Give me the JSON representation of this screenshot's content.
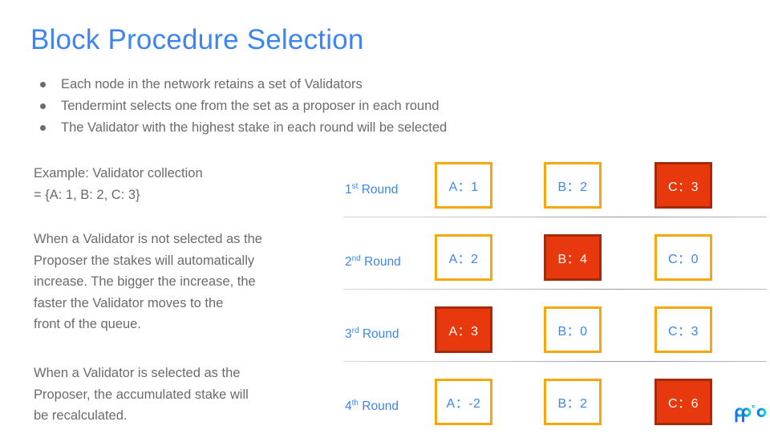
{
  "slide": {
    "title": "Block Procedure Selection",
    "background": "#ffffff",
    "accent_blue": "#3d85f0",
    "accent_orange": "#f8a70b",
    "accent_red": "#e8380d",
    "accent_red_border": "#a52a0a",
    "body_gray": "#6b6b6b"
  },
  "bullets": [
    {
      "text": "Each node in the network retains a set of Validators"
    },
    {
      "text": "Tendermint selects one from the set as a proposer in each round"
    },
    {
      "text": "The Validator with the highest stake in each round will be selected"
    }
  ],
  "paragraphs": {
    "example": {
      "lines": [
        "Example: Validator collection",
        "= {A: 1, B: 2, C: 3}"
      ]
    },
    "not_selected": {
      "lines": [
        "When a Validator is not selected as the",
        "Proposer the stakes will automatically",
        "increase. The bigger the increase, the",
        "faster the Validator moves to the",
        "front of the queue."
      ]
    },
    "selected": {
      "lines": [
        "When a Validator is selected as the",
        "Proposer, the accumulated stake will",
        "be recalculated."
      ]
    }
  },
  "diagram": {
    "rounds": [
      {
        "label_number": "1",
        "label_ordinal": "st",
        "label_suffix": " Round",
        "boxes": [
          {
            "label": "A：1",
            "selected": false
          },
          {
            "label": "B：2",
            "selected": false
          },
          {
            "label": "C：3",
            "selected": true
          }
        ]
      },
      {
        "label_number": "2",
        "label_ordinal": "nd",
        "label_suffix": " Round",
        "boxes": [
          {
            "label": "A：2",
            "selected": false
          },
          {
            "label": "B：4",
            "selected": true
          },
          {
            "label": "C：0",
            "selected": false
          }
        ]
      },
      {
        "label_number": "3",
        "label_ordinal": "rd",
        "label_suffix": " Round",
        "boxes": [
          {
            "label": "A：3",
            "selected": true
          },
          {
            "label": "B：0",
            "selected": false
          },
          {
            "label": "C：3",
            "selected": false
          }
        ]
      },
      {
        "label_number": "4",
        "label_ordinal": "th",
        "label_suffix": " Round",
        "boxes": [
          {
            "label": "A：-2",
            "selected": false
          },
          {
            "label": "B：2",
            "selected": false
          },
          {
            "label": "C：6",
            "selected": true
          }
        ]
      }
    ]
  },
  "logo": {
    "name": "ppio-logo",
    "gradient_from": "#1b6ff0",
    "gradient_to": "#12d8c8"
  }
}
